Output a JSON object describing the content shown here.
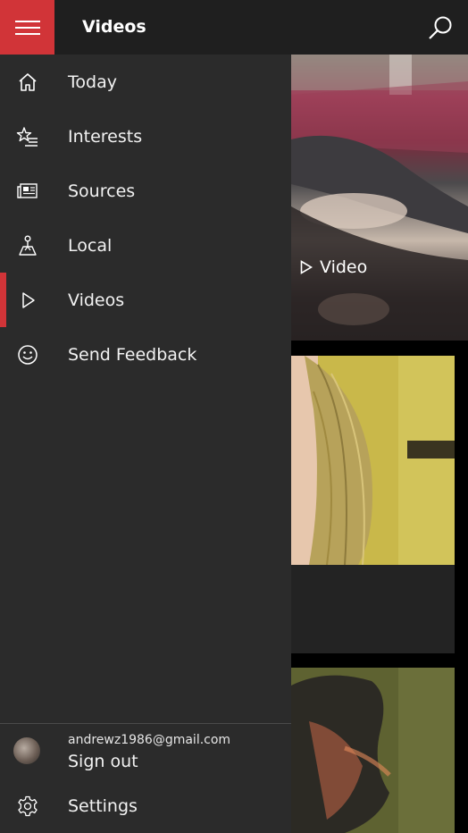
{
  "header": {
    "title": "Videos",
    "menu_icon": "hamburger-icon",
    "search_icon": "search-icon",
    "accent_color": "#d13438"
  },
  "nav": {
    "items": [
      {
        "label": "Today",
        "icon": "home-icon"
      },
      {
        "label": "Interests",
        "icon": "star-list-icon"
      },
      {
        "label": "Sources",
        "icon": "newspaper-icon"
      },
      {
        "label": "Local",
        "icon": "person-pin-icon"
      },
      {
        "label": "Videos",
        "icon": "play-icon",
        "selected": true
      },
      {
        "label": "Send Feedback",
        "icon": "smiley-icon"
      }
    ],
    "account": {
      "email": "andrewz1986@gmail.com",
      "sign_out": "Sign out"
    },
    "settings": {
      "label": "Settings",
      "icon": "gear-icon"
    }
  },
  "content": {
    "cards": [
      {
        "badge": "Video",
        "badge_icon": "play-icon"
      },
      {},
      {}
    ]
  }
}
